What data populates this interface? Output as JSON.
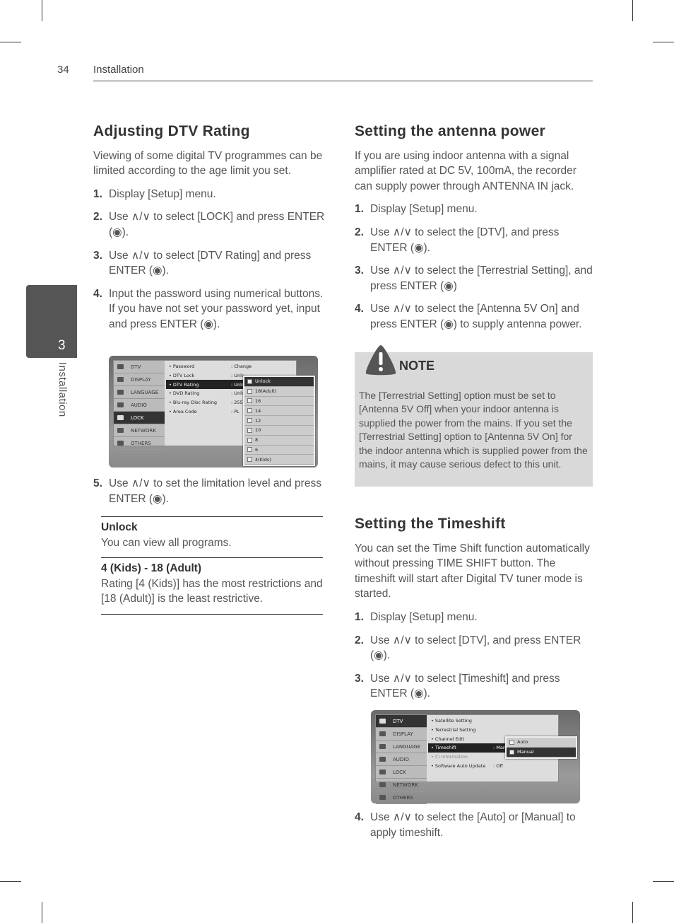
{
  "header": {
    "page_number": "34",
    "section": "Installation"
  },
  "side_tab": {
    "number": "3",
    "label": "Installation"
  },
  "left": {
    "title": "Adjusting DTV Rating",
    "intro": "Viewing of some digital TV programmes can be limited according to the age limit you set.",
    "steps": [
      {
        "n": "1.",
        "text": "Display [Setup] menu."
      },
      {
        "n": "2.",
        "text": "Use ∧/∨ to select [LOCK] and press ENTER (◉)."
      },
      {
        "n": "3.",
        "text": "Use ∧/∨ to select [DTV Rating] and press ENTER (◉)."
      },
      {
        "n": "4.",
        "text": "Input the password using numerical buttons.",
        "extra": "If you have not set your password yet, input and press ENTER (◉)."
      }
    ],
    "step5": {
      "n": "5.",
      "text": "Use ∧/∨ to set the limitation level and press ENTER (◉)."
    },
    "definitions": [
      {
        "term": "Unlock",
        "desc": "You can view all programs."
      },
      {
        "term": "4 (Kids) - 18 (Adult)",
        "desc": "Rating [4 (Kids)] has the most restrictions and [18 (Adult)] is the least restrictive."
      }
    ],
    "menu": {
      "categories": [
        "DTV",
        "DISPLAY",
        "LANGUAGE",
        "AUDIO",
        "LOCK",
        "NETWORK",
        "OTHERS"
      ],
      "selected_category": 4,
      "options": [
        {
          "label": "• Password",
          "value": ": Change"
        },
        {
          "label": "• DTV Lock",
          "value": ": Unlo"
        },
        {
          "label": "• DTV Rating",
          "value": ": Unlo",
          "sel": true
        },
        {
          "label": "• DVD Rating",
          "value": ": Unlo"
        },
        {
          "label": "• Blu-ray Disc Rating",
          "value": ": 255 \\"
        },
        {
          "label": "• Area Code",
          "value": ": PL"
        }
      ],
      "popup": [
        "Unlock",
        "18(Adult)",
        "16",
        "14",
        "12",
        "10",
        "8",
        "6",
        "4(Kids)"
      ],
      "popup_selected": 0
    }
  },
  "right": {
    "antenna": {
      "title": "Setting the antenna power",
      "intro": "If you are using indoor antenna with a signal amplifier rated at DC 5V, 100mA, the recorder can supply power through ANTENNA IN jack.",
      "steps": [
        {
          "n": "1.",
          "text": "Display [Setup] menu."
        },
        {
          "n": "2.",
          "text": "Use ∧/∨ to select the [DTV], and press ENTER (◉)."
        },
        {
          "n": "3.",
          "text": "Use ∧/∨ to select the [Terrestrial Setting], and press ENTER (◉)"
        },
        {
          "n": "4.",
          "text": "Use ∧/∨ to select the [Antenna 5V On] and press ENTER (◉) to supply antenna power."
        }
      ]
    },
    "note": {
      "title": "NOTE",
      "text": "The [Terrestrial Setting] option must be set to [Antenna 5V Off] when your indoor antenna is supplied the power from the mains. If you set the [Terrestrial Setting] option to [Antenna 5V On] for the indoor antenna which is supplied power from the mains, it may cause serious defect to this unit."
    },
    "timeshift": {
      "title": "Setting the Timeshift",
      "intro": "You can set the Time Shift function automatically without pressing TIME SHIFT button. The timeshift will start after Digital TV tuner mode is started.",
      "steps": [
        {
          "n": "1.",
          "text": "Display [Setup] menu."
        },
        {
          "n": "2.",
          "text": "Use ∧/∨ to select [DTV], and press ENTER (◉)."
        },
        {
          "n": "3.",
          "text": "Use ∧/∨ to select [Timeshift] and press ENTER (◉)."
        }
      ],
      "step4": {
        "n": "4.",
        "text": "Use ∧/∨ to select the [Auto] or [Manual] to apply timeshift."
      },
      "menu": {
        "categories": [
          "DTV",
          "DISPLAY",
          "LANGUAGE",
          "AUDIO",
          "LOCK",
          "NETWORK",
          "OTHERS"
        ],
        "selected_category": 0,
        "options": [
          {
            "label": "• Satellite Setting",
            "value": ""
          },
          {
            "label": "• Terrestrial Setting",
            "value": ""
          },
          {
            "label": "• Channel Edit",
            "value": ""
          },
          {
            "label": "• Timeshift",
            "value": ": Man",
            "sel": true
          },
          {
            "label": "• CI Information",
            "value": "",
            "dim": true
          },
          {
            "label": "• Software Auto Update",
            "value": ": Off"
          }
        ],
        "popup": [
          "Auto",
          "Manual"
        ],
        "popup_selected": 1
      }
    }
  }
}
